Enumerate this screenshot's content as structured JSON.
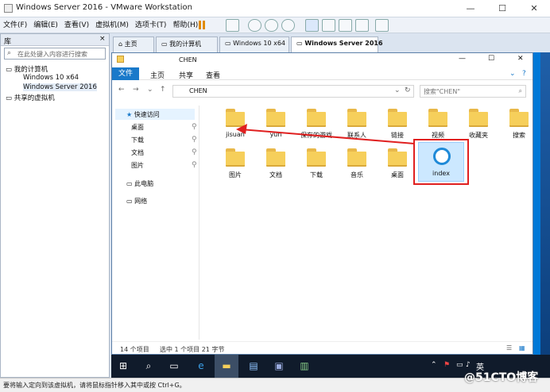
{
  "window": {
    "title": "Windows Server 2016 - VMware Workstation",
    "min": "—",
    "max": "☐",
    "close": "✕"
  },
  "menu": [
    "文件(F)",
    "编辑(E)",
    "查看(V)",
    "虚拟机(M)",
    "选项卡(T)",
    "帮助(H)"
  ],
  "library": {
    "title": "库",
    "close": "×",
    "search_placeholder": "在此处键入内容进行搜索",
    "my_computer": "我的计算机",
    "vms": [
      "Windows 10 x64",
      "Windows Server 2016"
    ],
    "shared": "共享的虚拟机"
  },
  "tabs": [
    {
      "label": "主页",
      "icon": "home-icon"
    },
    {
      "label": "我的计算机",
      "icon": "computer-icon"
    },
    {
      "label": "Windows 10 x64",
      "icon": "vm-icon"
    },
    {
      "label": "Windows Server 2016",
      "icon": "vm-icon"
    }
  ],
  "explorer": {
    "title": "CHEN",
    "ribbon": {
      "file": "文件",
      "tabs": [
        "主页",
        "共享",
        "查看"
      ],
      "help": "?"
    },
    "address": "CHEN",
    "search_placeholder": "搜索\"CHEN\"",
    "nav": {
      "quick": "快速访问",
      "items": [
        "桌面",
        "下载",
        "文档",
        "图片"
      ],
      "pc": "此电脑",
      "network": "网络"
    },
    "items_row1": [
      "jisuan",
      "yun",
      "保存的游戏",
      "联系人",
      "链接",
      "视频",
      "收藏夹",
      "搜索"
    ],
    "items_row2": [
      "图片",
      "文档",
      "下载",
      "音乐",
      "桌面",
      "index"
    ],
    "status": {
      "count": "14 个项目",
      "selected": "选中 1 个项目  21 字节"
    }
  },
  "taskbar": {
    "lang": "英"
  },
  "statusbar": {
    "hint": "要将输入定向到该虚拟机，请将鼠标指针移入其中或按 Ctrl+G。"
  },
  "watermark": "@51CTO博客",
  "colors": {
    "win_blue": "#0078d7",
    "selection_red": "#e02020",
    "ribbon_blue": "#1979ca"
  }
}
